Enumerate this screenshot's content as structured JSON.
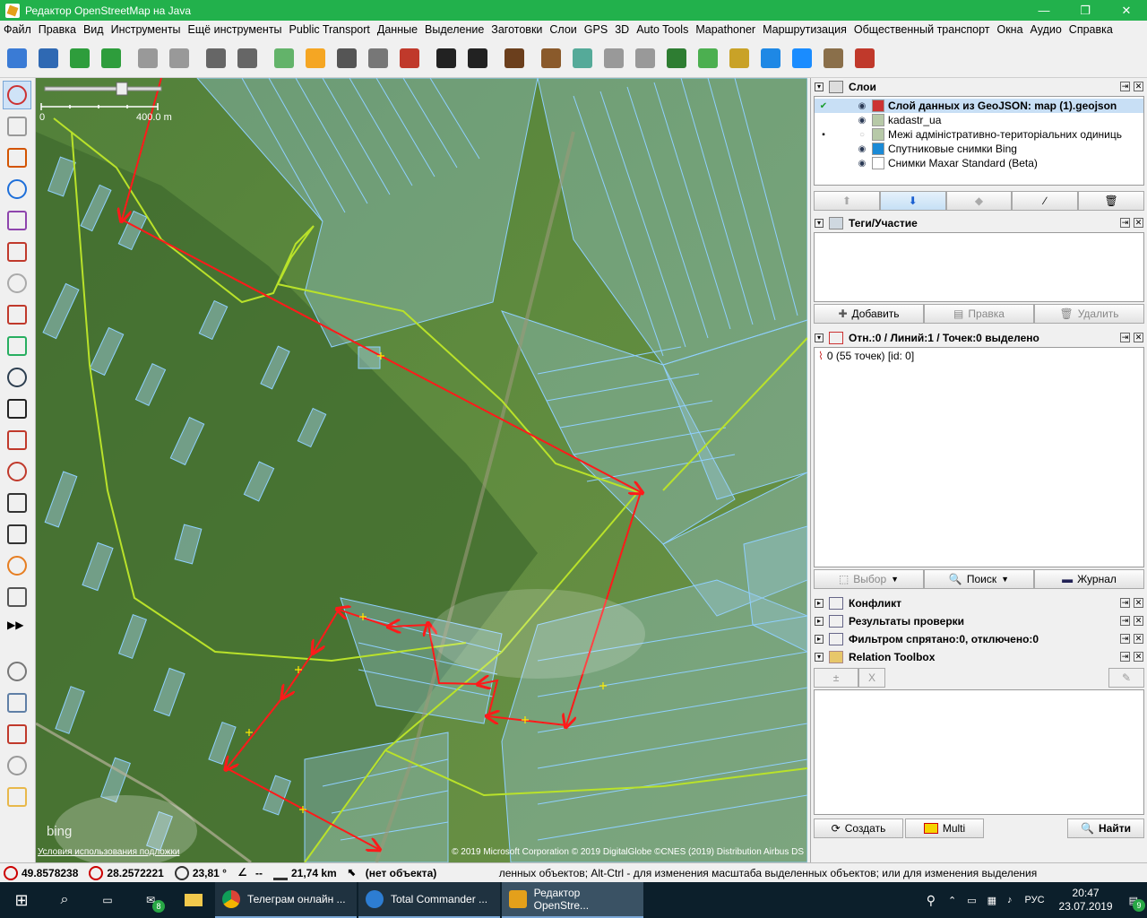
{
  "window": {
    "title": "Редактор OpenStreetMap на Java",
    "controls": [
      "—",
      "❐",
      "✕"
    ]
  },
  "menu": [
    "Файл",
    "Правка",
    "Вид",
    "Инструменты",
    "Ещё инструменты",
    "Public Transport",
    "Данные",
    "Выделение",
    "Заготовки",
    "Слои",
    "GPS",
    "3D",
    "Auto Tools",
    "Mapathoner",
    "Маршрутизация",
    "Общественный транспорт",
    "Окна",
    "Аудио",
    "Справка"
  ],
  "toolbar_icons": [
    "open-icon",
    "save-icon",
    "download-icon",
    "upload-icon",
    "undo-icon",
    "redo-icon",
    "preferences-icon",
    "wireframe-icon",
    "zoom-extents-icon",
    "highway-icon",
    "road-icon",
    "street-lamp-icon",
    "barrier-icon",
    "car-icon",
    "bus-icon",
    "restaurant-icon",
    "industrial-icon",
    "recycling-icon",
    "tools-icon",
    "shop-icon",
    "forest-icon",
    "grass-icon",
    "farmland-icon",
    "water-icon",
    "wetland-icon",
    "wall-icon",
    "satellite-icon"
  ],
  "left_tools": [
    "select-icon",
    "lasso-icon",
    "draw-icon",
    "zoom-icon",
    "delete-icon",
    "improve-way-icon",
    "parallel-icon",
    "split-icon",
    "extract-icon",
    "route-icon",
    "bus-stop-icon",
    "sync-icon",
    "line-icon",
    "node-icon",
    "tool-icon",
    "pencil-icon",
    "building-icon",
    "more-icon",
    "layers-toggle-icon",
    "tags-toggle-icon",
    "selection-toggle-icon",
    "filter-toggle-icon",
    "toolbox-toggle-icon"
  ],
  "map": {
    "scale_label": "400.0 m",
    "scale_zero": "0",
    "attribution_left": "Условия использования подложки",
    "attribution_right": "© 2019 Microsoft Corporation © 2019 DigitalGlobe ©CNES (2019) Distribution Airbus DS",
    "bing_logo": "bing"
  },
  "layers_panel": {
    "title": "Слои",
    "layers": [
      {
        "name": "Слой данных из GeoJSON: map (1).geojson",
        "active": true,
        "visible": true
      },
      {
        "name": "kadastr_ua",
        "active": false,
        "visible": true
      },
      {
        "name": "Межі адміністративно-територіальних одиниць",
        "active": false,
        "visible": false
      },
      {
        "name": "Спутниковые снимки Bing",
        "active": false,
        "visible": true
      },
      {
        "name": "Снимки Maxar Standard (Beta)",
        "active": false,
        "visible": true
      }
    ]
  },
  "tags_panel": {
    "title": "Теги/Участие",
    "add": "Добавить",
    "edit": "Правка",
    "delete": "Удалить"
  },
  "selection_panel": {
    "title": "Отн.:0 / Линий:1 / Точек:0 выделено",
    "item": "0 (55 точек) [id: 0]",
    "select": "Выбор",
    "search": "Поиск",
    "history": "Журнал"
  },
  "collapsed_panels": [
    "Конфликт",
    "Результаты проверки",
    "Фильтром спрятано:0, отключено:0"
  ],
  "relation_toolbox": {
    "title": "Relation Toolbox",
    "create": "Создать",
    "multi": "Multi",
    "find": "Найти"
  },
  "status": {
    "lat": "49.8578238",
    "lon": "28.2572221",
    "heading": "23,81 °",
    "angle": "--",
    "distance": "21,74 km",
    "object": "(нет объекта)",
    "help": "ленных объектов; Alt-Ctrl - для изменения масштаба выделенных объектов; или для изменения выделения"
  },
  "taskbar": {
    "tasks": [
      "Телеграм онлайн ...",
      "Total Commander ...",
      "Редактор OpenStre..."
    ],
    "mail_badge": "8",
    "lang": "РУС",
    "time": "20:47",
    "date": "23.07.2019",
    "notif_badge": "9"
  },
  "colors": {
    "titlebar": "#22b14c",
    "route": "#ff1a1a",
    "parcel": "#8fd0ff",
    "boundary": "#b9e22a"
  }
}
